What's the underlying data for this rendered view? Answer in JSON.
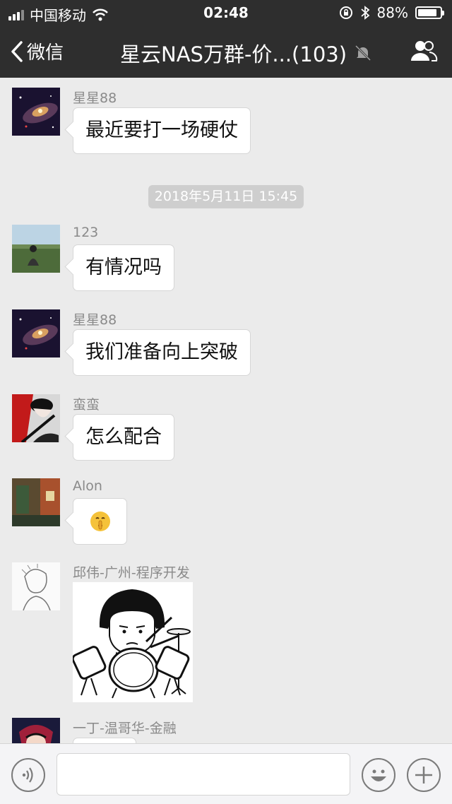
{
  "status_bar": {
    "carrier": "中国移动",
    "time": "02:48",
    "battery_percent": "88%",
    "battery_level": 0.88,
    "icons": [
      "signal-icon",
      "wifi-icon",
      "rotation-lock-icon",
      "bluetooth-icon",
      "battery-icon"
    ]
  },
  "nav": {
    "back_label": "微信",
    "title": "星云NAS万群-价...(103)",
    "icons": [
      "chevron-left-icon",
      "mute-bell-icon",
      "group-members-icon"
    ]
  },
  "messages": [
    {
      "sender": "星星88",
      "text": "最近要打一场硬仗"
    },
    {
      "timestamp": "2018年5月11日 15:45"
    },
    {
      "sender": "123",
      "text": "有情况吗"
    },
    {
      "sender": "星星88",
      "text": "我们准备向上突破"
    },
    {
      "sender": "蛮蛮",
      "text": "怎么配合"
    },
    {
      "sender": "Alon",
      "emoji": "🤫"
    },
    {
      "sender": "邱伟-广州-程序开发",
      "sticker": "drummer-sticker"
    },
    {
      "sender": "一丁-温哥华-金融",
      "text": ""
    }
  ],
  "input_bar": {
    "icons": [
      "voice-icon",
      "emoji-icon",
      "plus-icon"
    ],
    "placeholder": ""
  },
  "colors": {
    "header_bg": "#2e2e2e",
    "chat_bg": "#ebebeb",
    "bubble_bg": "#ffffff",
    "timestamp_bg": "#cecece"
  }
}
